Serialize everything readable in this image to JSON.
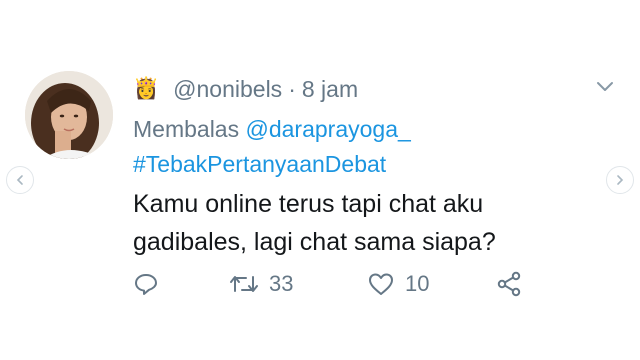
{
  "user": {
    "emoji": "👸",
    "handle": "@nonibels",
    "time": "8 jam"
  },
  "reply": {
    "prefix": "Membalas",
    "mention": "@daraprayoga_"
  },
  "hashtag": "#TebakPertanyaanDebat",
  "text": {
    "line1": "Kamu online terus tapi chat aku",
    "line2": "gadibales, lagi chat sama siapa?"
  },
  "stats": {
    "retweets": "33",
    "likes": "10"
  },
  "colors": {
    "link": "#1b95e0",
    "muted": "#657786",
    "text": "#14171a"
  },
  "icons": [
    "reply-icon",
    "retweet-icon",
    "heart-icon",
    "share-icon",
    "chevron-down-icon",
    "chevron-left-icon",
    "chevron-right-icon"
  ]
}
